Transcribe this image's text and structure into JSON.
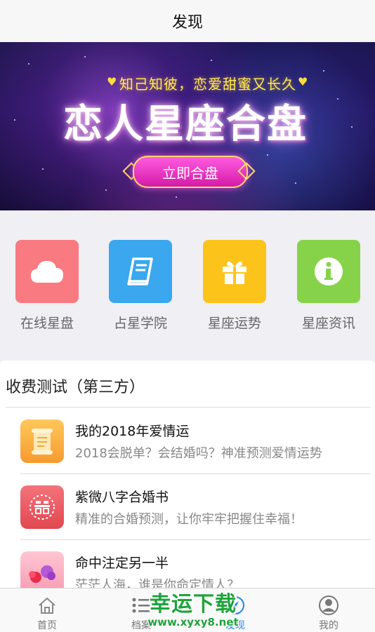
{
  "header": {
    "title": "发现"
  },
  "banner": {
    "subtitle": "知己知彼，恋爱甜蜜又长久",
    "title": "恋人星座合盘",
    "cta_label": "立即合盘"
  },
  "grid": [
    {
      "label": "在线星盘",
      "icon": "cloud-icon",
      "color": "#f97a80"
    },
    {
      "label": "占星学院",
      "icon": "book-icon",
      "color": "#3aa7ef"
    },
    {
      "label": "星座运势",
      "icon": "gift-icon",
      "color": "#fcc31b"
    },
    {
      "label": "星座资讯",
      "icon": "info-icon",
      "color": "#86d34a"
    }
  ],
  "section": {
    "title": "收费测试（第三方）",
    "items": [
      {
        "title": "我的2018年爱情运",
        "desc": "2018会脱单？会结婚吗？神准预测爱情运势",
        "icon": "scroll-icon"
      },
      {
        "title": "紫微八字合婚书",
        "desc": "精准的合婚预测，让你牢牢把握住幸福！",
        "icon": "double-happiness-icon"
      },
      {
        "title": "命中注定另一半",
        "desc": "茫茫人海，谁是你命定情人？",
        "icon": "flowers-icon"
      }
    ]
  },
  "tabbar": {
    "items": [
      {
        "label": "首页",
        "icon": "home-icon"
      },
      {
        "label": "档案",
        "icon": "list-icon"
      },
      {
        "label": "发现",
        "icon": "compass-icon",
        "active": true
      },
      {
        "label": "我的",
        "icon": "user-icon"
      }
    ]
  },
  "watermark": {
    "line1": "幸运下载",
    "line2": "www.xyxy8.net"
  },
  "colors": {
    "accent": "#1a88f0",
    "watermark": "#1fa33b"
  }
}
